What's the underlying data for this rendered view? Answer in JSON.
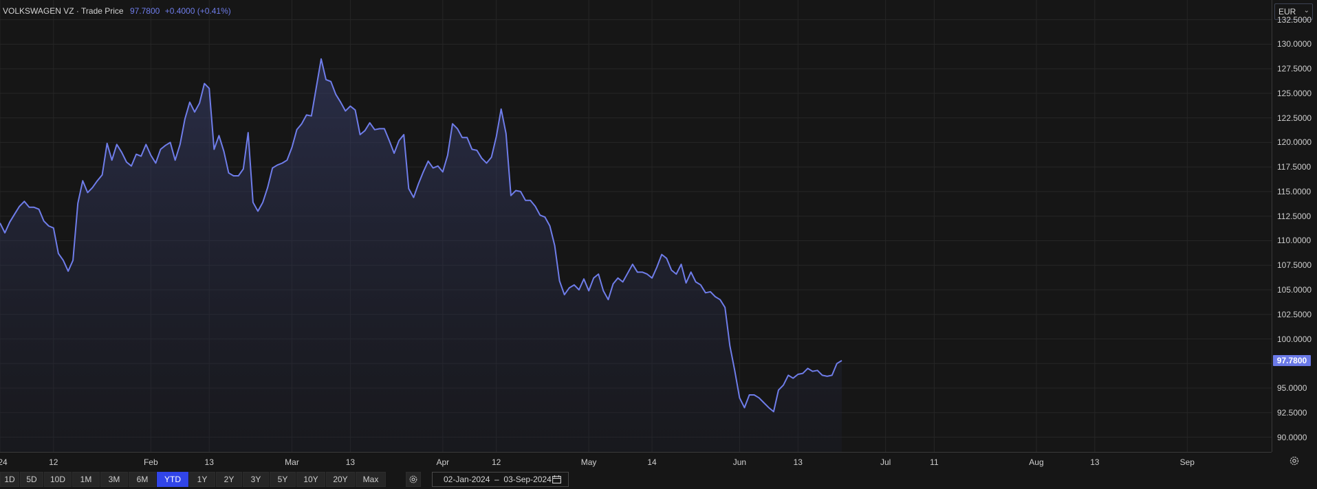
{
  "legend": {
    "instrument": "VOLKSWAGEN VZ · Trade Price",
    "price": "97.7800",
    "change": "+0.4000 (+0.41%)"
  },
  "currency": {
    "value": "EUR",
    "icon": "chevron-down-icon"
  },
  "price_tag": "97.7800",
  "chart_data": {
    "type": "area",
    "ylim": [
      88.5,
      134.5
    ],
    "y_ticks": [
      "132.5000",
      "130.0000",
      "127.5000",
      "125.0000",
      "122.5000",
      "120.0000",
      "117.5000",
      "115.0000",
      "112.5000",
      "110.0000",
      "107.5000",
      "105.0000",
      "102.5000",
      "100.0000",
      "97.5000",
      "95.0000",
      "92.5000",
      "90.0000"
    ],
    "y_tick_values": [
      132.5,
      130,
      127.5,
      125,
      122.5,
      120,
      117.5,
      115,
      112.5,
      110,
      107.5,
      105,
      102.5,
      100,
      97.5,
      95,
      92.5,
      90
    ],
    "x_ticks": [
      {
        "label": "24",
        "date": "2024-01-01"
      },
      {
        "label": "12",
        "date": "2024-01-12"
      },
      {
        "label": "Feb",
        "date": "2024-02-01"
      },
      {
        "label": "13",
        "date": "2024-02-13"
      },
      {
        "label": "Mar",
        "date": "2024-03-01"
      },
      {
        "label": "13",
        "date": "2024-03-13"
      },
      {
        "label": "Apr",
        "date": "2024-04-01"
      },
      {
        "label": "12",
        "date": "2024-04-12"
      },
      {
        "label": "May",
        "date": "2024-05-01"
      },
      {
        "label": "14",
        "date": "2024-05-14"
      },
      {
        "label": "Jun",
        "date": "2024-06-01"
      },
      {
        "label": "13",
        "date": "2024-06-13"
      },
      {
        "label": "Jul",
        "date": "2024-07-01"
      },
      {
        "label": "11",
        "date": "2024-07-11"
      },
      {
        "label": "Aug",
        "date": "2024-08-01"
      },
      {
        "label": "13",
        "date": "2024-08-13"
      },
      {
        "label": "Sep",
        "date": "2024-09-01"
      }
    ],
    "x_range": [
      "2024-01-01",
      "2024-09-10"
    ],
    "grid": true,
    "line_color": "#6f7dea",
    "series": [
      {
        "points": [
          [
            "2024-01-01",
            111.8
          ],
          [
            "2024-01-02",
            110.8
          ],
          [
            "2024-01-03",
            111.9
          ],
          [
            "2024-01-04",
            112.7
          ],
          [
            "2024-01-05",
            113.5
          ],
          [
            "2024-01-06",
            114.0
          ],
          [
            "2024-01-07",
            113.4
          ],
          [
            "2024-01-08",
            113.4
          ],
          [
            "2024-01-09",
            113.2
          ],
          [
            "2024-01-10",
            112.0
          ],
          [
            "2024-01-11",
            111.5
          ],
          [
            "2024-01-12",
            111.3
          ],
          [
            "2024-01-13",
            108.7
          ],
          [
            "2024-01-14",
            108.0
          ],
          [
            "2024-01-15",
            106.9
          ],
          [
            "2024-01-16",
            108.0
          ],
          [
            "2024-01-17",
            113.8
          ],
          [
            "2024-01-18",
            116.1
          ],
          [
            "2024-01-19",
            114.9
          ],
          [
            "2024-01-20",
            115.4
          ],
          [
            "2024-01-21",
            116.1
          ],
          [
            "2024-01-22",
            116.7
          ],
          [
            "2024-01-23",
            119.9
          ],
          [
            "2024-01-24",
            118.2
          ],
          [
            "2024-01-25",
            119.8
          ],
          [
            "2024-01-26",
            119.0
          ],
          [
            "2024-01-27",
            118.0
          ],
          [
            "2024-01-28",
            117.6
          ],
          [
            "2024-01-29",
            118.8
          ],
          [
            "2024-01-30",
            118.6
          ],
          [
            "2024-01-31",
            119.8
          ],
          [
            "2024-02-01",
            118.7
          ],
          [
            "2024-02-02",
            117.9
          ],
          [
            "2024-02-03",
            119.3
          ],
          [
            "2024-02-04",
            119.7
          ],
          [
            "2024-02-05",
            120.0
          ],
          [
            "2024-02-06",
            118.2
          ],
          [
            "2024-02-07",
            119.8
          ],
          [
            "2024-02-08",
            122.4
          ],
          [
            "2024-02-09",
            124.1
          ],
          [
            "2024-02-10",
            123.1
          ],
          [
            "2024-02-11",
            124.0
          ],
          [
            "2024-02-12",
            126.0
          ],
          [
            "2024-02-13",
            125.5
          ],
          [
            "2024-02-14",
            119.3
          ],
          [
            "2024-02-15",
            120.7
          ],
          [
            "2024-02-16",
            119.1
          ],
          [
            "2024-02-17",
            116.9
          ],
          [
            "2024-02-18",
            116.6
          ],
          [
            "2024-02-19",
            116.6
          ],
          [
            "2024-02-20",
            117.3
          ],
          [
            "2024-02-21",
            121.0
          ],
          [
            "2024-02-22",
            113.9
          ],
          [
            "2024-02-23",
            113.0
          ],
          [
            "2024-02-24",
            113.9
          ],
          [
            "2024-02-25",
            115.4
          ],
          [
            "2024-02-26",
            117.4
          ],
          [
            "2024-02-27",
            117.7
          ],
          [
            "2024-02-28",
            117.9
          ],
          [
            "2024-02-29",
            118.2
          ],
          [
            "2024-03-01",
            119.5
          ],
          [
            "2024-03-02",
            121.3
          ],
          [
            "2024-03-03",
            121.9
          ],
          [
            "2024-03-04",
            122.8
          ],
          [
            "2024-03-05",
            122.7
          ],
          [
            "2024-03-06",
            125.6
          ],
          [
            "2024-03-07",
            128.5
          ],
          [
            "2024-03-08",
            126.4
          ],
          [
            "2024-03-09",
            126.2
          ],
          [
            "2024-03-10",
            124.9
          ],
          [
            "2024-03-11",
            124.1
          ],
          [
            "2024-03-12",
            123.2
          ],
          [
            "2024-03-13",
            123.7
          ],
          [
            "2024-03-14",
            123.3
          ],
          [
            "2024-03-15",
            120.8
          ],
          [
            "2024-03-16",
            121.2
          ],
          [
            "2024-03-17",
            122.0
          ],
          [
            "2024-03-18",
            121.3
          ],
          [
            "2024-03-19",
            121.4
          ],
          [
            "2024-03-20",
            121.4
          ],
          [
            "2024-03-21",
            120.2
          ],
          [
            "2024-03-22",
            118.9
          ],
          [
            "2024-03-23",
            120.2
          ],
          [
            "2024-03-24",
            120.8
          ],
          [
            "2024-03-25",
            115.3
          ],
          [
            "2024-03-26",
            114.4
          ],
          [
            "2024-03-27",
            115.8
          ],
          [
            "2024-03-28",
            117.0
          ],
          [
            "2024-03-29",
            118.1
          ],
          [
            "2024-03-30",
            117.4
          ],
          [
            "2024-03-31",
            117.6
          ],
          [
            "2024-04-01",
            117.0
          ],
          [
            "2024-04-02",
            118.7
          ],
          [
            "2024-04-03",
            121.9
          ],
          [
            "2024-04-04",
            121.4
          ],
          [
            "2024-04-05",
            120.5
          ],
          [
            "2024-04-06",
            120.5
          ],
          [
            "2024-04-07",
            119.3
          ],
          [
            "2024-04-08",
            119.2
          ],
          [
            "2024-04-09",
            118.4
          ],
          [
            "2024-04-10",
            117.9
          ],
          [
            "2024-04-11",
            118.5
          ],
          [
            "2024-04-12",
            120.6
          ],
          [
            "2024-04-13",
            123.4
          ],
          [
            "2024-04-14",
            120.9
          ],
          [
            "2024-04-15",
            114.6
          ],
          [
            "2024-04-16",
            115.1
          ],
          [
            "2024-04-17",
            115.0
          ],
          [
            "2024-04-18",
            114.1
          ],
          [
            "2024-04-19",
            114.1
          ],
          [
            "2024-04-20",
            113.5
          ],
          [
            "2024-04-21",
            112.6
          ],
          [
            "2024-04-22",
            112.4
          ],
          [
            "2024-04-23",
            111.5
          ],
          [
            "2024-04-24",
            109.5
          ],
          [
            "2024-04-25",
            105.9
          ],
          [
            "2024-04-26",
            104.5
          ],
          [
            "2024-04-27",
            105.2
          ],
          [
            "2024-04-28",
            105.5
          ],
          [
            "2024-04-29",
            105.0
          ],
          [
            "2024-04-30",
            106.1
          ],
          [
            "2024-05-01",
            104.9
          ],
          [
            "2024-05-02",
            106.2
          ],
          [
            "2024-05-03",
            106.6
          ],
          [
            "2024-05-04",
            104.9
          ],
          [
            "2024-05-05",
            104.0
          ],
          [
            "2024-05-06",
            105.6
          ],
          [
            "2024-05-07",
            106.2
          ],
          [
            "2024-05-08",
            105.8
          ],
          [
            "2024-05-09",
            106.7
          ],
          [
            "2024-05-10",
            107.6
          ],
          [
            "2024-05-11",
            106.8
          ],
          [
            "2024-05-12",
            106.8
          ],
          [
            "2024-05-13",
            106.6
          ],
          [
            "2024-05-14",
            106.2
          ],
          [
            "2024-05-15",
            107.3
          ],
          [
            "2024-05-16",
            108.6
          ],
          [
            "2024-05-17",
            108.2
          ],
          [
            "2024-05-18",
            107.0
          ],
          [
            "2024-05-19",
            106.6
          ],
          [
            "2024-05-20",
            107.6
          ],
          [
            "2024-05-21",
            105.7
          ],
          [
            "2024-05-22",
            106.8
          ],
          [
            "2024-05-23",
            105.8
          ],
          [
            "2024-05-24",
            105.5
          ],
          [
            "2024-05-25",
            104.7
          ],
          [
            "2024-05-26",
            104.8
          ],
          [
            "2024-05-27",
            104.3
          ],
          [
            "2024-05-28",
            104.0
          ],
          [
            "2024-05-29",
            103.2
          ],
          [
            "2024-05-30",
            99.3
          ],
          [
            "2024-05-31",
            96.8
          ],
          [
            "2024-06-01",
            94.0
          ],
          [
            "2024-06-02",
            93.0
          ],
          [
            "2024-06-03",
            94.3
          ],
          [
            "2024-06-04",
            94.3
          ],
          [
            "2024-06-05",
            94.0
          ],
          [
            "2024-06-06",
            93.5
          ],
          [
            "2024-06-07",
            93.0
          ],
          [
            "2024-06-08",
            92.6
          ],
          [
            "2024-06-09",
            94.8
          ],
          [
            "2024-06-10",
            95.3
          ],
          [
            "2024-06-11",
            96.3
          ],
          [
            "2024-06-12",
            96.0
          ],
          [
            "2024-06-13",
            96.4
          ],
          [
            "2024-06-14",
            96.5
          ],
          [
            "2024-06-15",
            97.0
          ],
          [
            "2024-06-16",
            96.7
          ],
          [
            "2024-06-17",
            96.8
          ],
          [
            "2024-06-18",
            96.3
          ],
          [
            "2024-06-19",
            96.2
          ],
          [
            "2024-06-20",
            96.3
          ],
          [
            "2024-06-21",
            97.5
          ],
          [
            "2024-06-22",
            97.8
          ]
        ]
      }
    ]
  },
  "ranges": [
    "1D",
    "5D",
    "10D",
    "1M",
    "3M",
    "6M",
    "YTD",
    "1Y",
    "2Y",
    "3Y",
    "5Y",
    "10Y",
    "20Y",
    "Max"
  ],
  "active_range": "YTD",
  "date_range": {
    "text": "02-Jan-2024  –  03-Sep-2024",
    "icon": "calendar-icon"
  },
  "settings_icon": "gear-icon"
}
